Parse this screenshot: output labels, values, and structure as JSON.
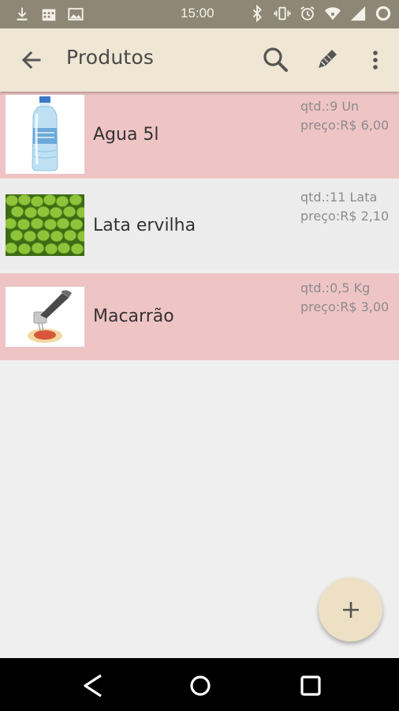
{
  "status_bar": {
    "time": "15:00",
    "left_icons": [
      "download-icon",
      "calendar-icon",
      "image-icon"
    ],
    "right_icons": [
      "bluetooth-icon",
      "vibrate-icon",
      "alarm-icon",
      "wifi-icon",
      "signal-icon",
      "battery-icon"
    ],
    "background": "#8e8775"
  },
  "toolbar": {
    "title": "Produtos",
    "background": "#efe6d3",
    "icons": [
      "back-arrow-icon",
      "search-icon",
      "edit-icon",
      "more-vert-icon"
    ]
  },
  "products": [
    {
      "name": "Agua 5l",
      "qty": "qtd.:9 Un",
      "price": "preço:R$ 6,00",
      "image": "water-bottle-image",
      "row_color": "#efc4c5"
    },
    {
      "name": "Lata ervilha",
      "qty": "qtd.:11 Lata",
      "price": "preço:R$ 2,10",
      "image": "peas-image",
      "row_color": "#ececec"
    },
    {
      "name": "Macarrão",
      "qty": "qtd.:0,5 Kg",
      "price": "preço:R$ 3,00",
      "image": "pasta-image",
      "row_color": "#efc4c5"
    }
  ],
  "fab": {
    "icon": "plus-icon",
    "background": "#eee0c5"
  },
  "nav_bar": {
    "icons": [
      "nav-back-icon",
      "nav-home-icon",
      "nav-recents-icon"
    ]
  }
}
